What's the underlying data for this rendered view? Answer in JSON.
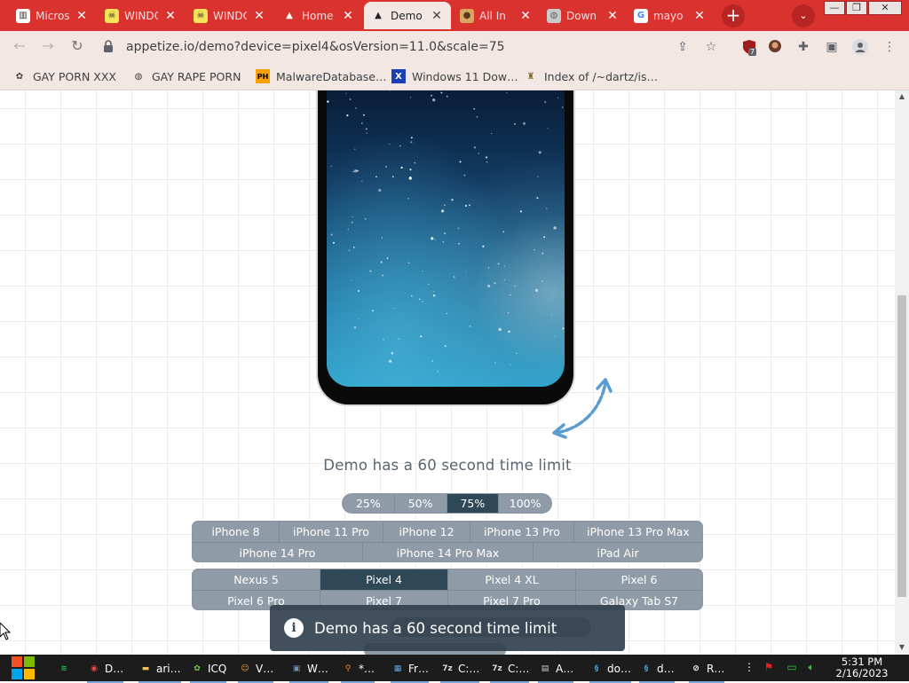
{
  "browser": {
    "tabs": [
      {
        "title": "Micros",
        "icon": "institution-icon",
        "active": false
      },
      {
        "title": "WINDO",
        "icon": "pixel-skull-icon",
        "active": false
      },
      {
        "title": "WINDO",
        "icon": "pixel-skull-icon",
        "active": false
      },
      {
        "title": "Home",
        "icon": "appetize-logo-icon",
        "active": false
      },
      {
        "title": "Demo",
        "icon": "appetize-logo-icon",
        "active": true
      },
      {
        "title": "All In",
        "icon": "cookie-icon",
        "active": false
      },
      {
        "title": "Down",
        "icon": "globe-icon",
        "active": false
      },
      {
        "title": "mayo",
        "icon": "google-icon",
        "active": false
      }
    ],
    "new_tab_symbol": "+",
    "tab_search_symbol": "⌄",
    "window_controls": [
      "—",
      "❐",
      "✕"
    ],
    "url": "appetize.io/demo?device=pixel4&osVersion=11.0&scale=75",
    "extension_badge": "7",
    "bookmarks": [
      {
        "label": "GAY PORN XXX",
        "icon": "bookmark-site-icon"
      },
      {
        "label": "GAY RAPE PORN",
        "icon": "globe-icon"
      },
      {
        "label": "MalwareDatabase…",
        "icon": "ph-icon"
      },
      {
        "label": "Windows 11 Dow…",
        "icon": "x-logo-icon"
      },
      {
        "label": "Index of /~dartz/is…",
        "icon": "monument-icon"
      }
    ]
  },
  "page": {
    "time_limit_text": "Demo has a 60 second time limit",
    "zoom_options": [
      "25%",
      "50%",
      "75%",
      "100%"
    ],
    "zoom_selected": "75%",
    "iphone_row1": [
      "iPhone 8",
      "iPhone 11 Pro",
      "iPhone 12",
      "iPhone 13 Pro",
      "iPhone 13 Pro Max"
    ],
    "iphone_row2": [
      "iPhone 14 Pro",
      "iPhone 14 Pro Max",
      "iPad Air"
    ],
    "android_row1": [
      "Nexus 5",
      "Pixel 4",
      "Pixel 4 XL",
      "Pixel 6"
    ],
    "android_row2": [
      "Pixel 6 Pro",
      "Pixel 7",
      "Pixel 7 Pro",
      "Galaxy Tab S7"
    ],
    "device_selected": "Pixel 4",
    "toast_text": "Demo has a 60 second time limit",
    "toast_icon": "i"
  },
  "taskbar": {
    "items": [
      {
        "label": "",
        "icon": "spotify-icon",
        "color": "#1db954"
      },
      {
        "label": "D…",
        "icon": "chrome-icon",
        "color": "#e8453c"
      },
      {
        "label": "ari…",
        "icon": "folder-icon",
        "color": "#f2c14e"
      },
      {
        "label": "ICQ",
        "icon": "icq-flower-icon",
        "color": "#7ac943"
      },
      {
        "label": "V…",
        "icon": "user-app-icon",
        "color": "#f0a040"
      },
      {
        "label": "W…",
        "icon": "monitor-app-icon",
        "color": "#6d8fb0"
      },
      {
        "label": "*…",
        "icon": "search-app-icon",
        "color": "#f08a24"
      },
      {
        "label": "Fr…",
        "icon": "photo-app-icon",
        "color": "#5aa0e0"
      },
      {
        "label": "C:…",
        "icon": "7zip-icon",
        "color": "#dddddd"
      },
      {
        "label": "C:…",
        "icon": "7zip-icon",
        "color": "#dddddd"
      },
      {
        "label": "A…",
        "icon": "console-icon",
        "color": "#cccccc"
      },
      {
        "label": "do…",
        "icon": "script-icon",
        "color": "#4a9fd8"
      },
      {
        "label": "d…",
        "icon": "script-icon",
        "color": "#4a9fd8"
      },
      {
        "label": "R…",
        "icon": "no-entry-icon",
        "color": "#ffffff"
      }
    ],
    "time": "5:31 PM",
    "date": "2/16/2023"
  },
  "colors": {
    "tabstrip": "#d9322f",
    "toolbar": "#f3e7e4",
    "segment": "#8f9ba7",
    "segment_selected": "#2f4858",
    "toast": "#344250"
  }
}
